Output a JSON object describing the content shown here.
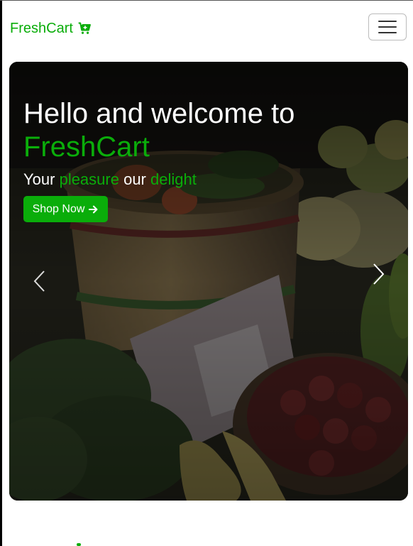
{
  "navbar": {
    "brand_name": "FreshCart",
    "brand_icon": "cart-plus-icon",
    "toggler_icon": "hamburger-menu-icon"
  },
  "hero": {
    "title_prefix": "Hello and welcome to ",
    "title_highlight": "FreshCart",
    "subtitle_part1": "Your ",
    "subtitle_part2": "pleasure",
    "subtitle_part3": " our ",
    "subtitle_part4": "delight",
    "button_label": "Shop Now",
    "button_icon": "arrow-right-icon",
    "prev_icon": "chevron-left-icon",
    "next_icon": "chevron-right-icon"
  },
  "colors": {
    "accent": "#0aad0a",
    "text_light": "#ffffff"
  }
}
